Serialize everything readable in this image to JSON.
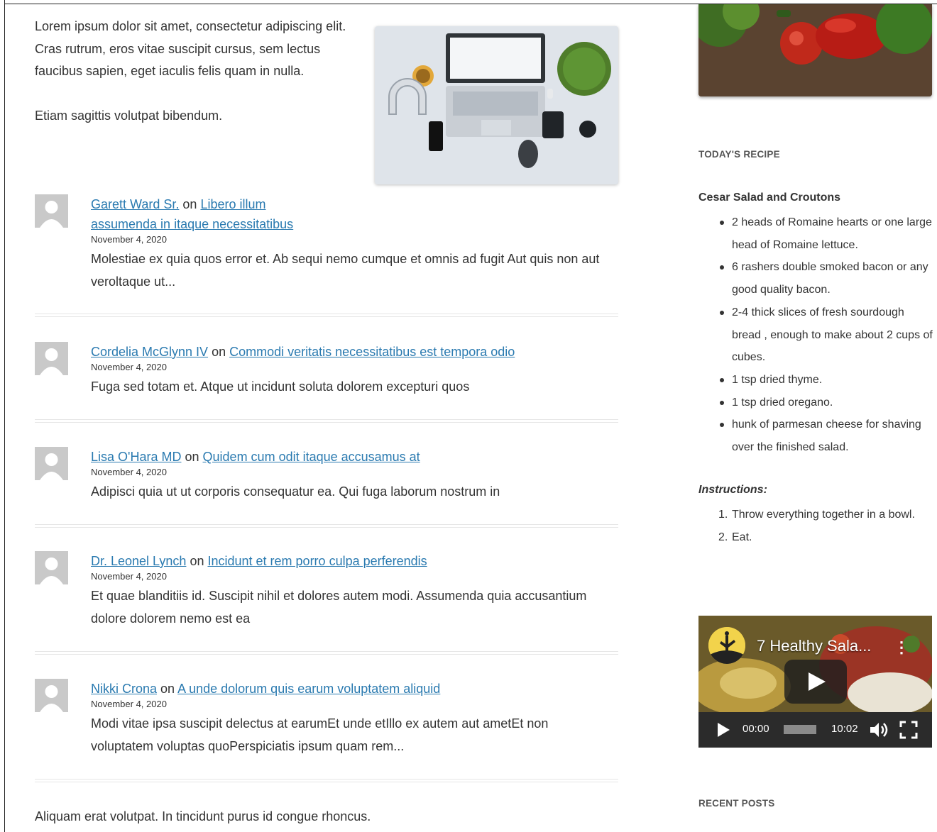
{
  "intro": {
    "paragraph1": "Lorem ipsum dolor sit amet, consectetur adipiscing elit. Cras rutrum, eros vitae suscipit cursus, sem lectus faucibus sapien, eget iaculis felis quam in nulla.",
    "paragraph2": "Etiam sagittis volutpat bibendum."
  },
  "comments": [
    {
      "author": "Garett Ward Sr.",
      "on": "on",
      "post": "Libero illum assumenda in itaque necessitatibus",
      "date": "November 4, 2020",
      "excerpt": "Molestiae ex quia quos error et. Ab sequi nemo cumque et omnis ad fugit Aut quis non aut veroltaque ut..."
    },
    {
      "author": "Cordelia McGlynn IV",
      "on": "on",
      "post": "Commodi veritatis necessitatibus est tempora odio",
      "date": "November 4, 2020",
      "excerpt": "Fuga sed totam et. Atque ut incidunt soluta dolorem excepturi quos"
    },
    {
      "author": "Lisa O'Hara MD",
      "on": "on",
      "post": "Quidem cum odit itaque accusamus at",
      "date": "November 4, 2020",
      "excerpt": "Adipisci quia ut ut corporis consequatur ea. Qui fuga laborum nostrum in"
    },
    {
      "author": "Dr. Leonel Lynch",
      "on": "on",
      "post": "Incidunt et rem porro culpa perferendis",
      "date": "November 4, 2020",
      "excerpt": "Et quae blanditiis id. Suscipit nihil et dolores autem modi. Assumenda quia accusantium dolore dolorem nemo est ea"
    },
    {
      "author": "Nikki Crona",
      "on": "on",
      "post": "A unde dolorum quis earum voluptatem aliquid",
      "date": "November 4, 2020",
      "excerpt": "Modi vitae ipsa suscipit delectus at earumEt unde etIllo ex autem aut ametEt non voluptatem voluptas quoPerspiciatis ipsum quam rem..."
    }
  ],
  "outro": "Aliquam erat volutpat. In tincidunt purus id congue rhoncus.",
  "sidebar": {
    "recipe_widget_title": "TODAY'S RECIPE",
    "recipe_title": "Cesar Salad and Croutons",
    "ingredients": [
      "2 heads of Romaine hearts or one large head of Romaine lettuce.",
      "6 rashers double smoked bacon or any good quality bacon.",
      "2-4 thick slices of fresh sourdough bread , enough to make about 2 cups of cubes.",
      "1 tsp dried thyme.",
      "1 tsp dried oregano.",
      "hunk of parmesan cheese for shaving over the finished salad."
    ],
    "instructions_label": "Instructions:",
    "steps": [
      {
        "num": "1.",
        "text": "Throw everything together in a bowl."
      },
      {
        "num": "2.",
        "text": "Eat."
      }
    ],
    "video": {
      "title": "7 Healthy Sala...",
      "menu": "⋮",
      "current_time": "00:00",
      "duration": "10:02"
    },
    "recent_posts_title": "RECENT POSTS"
  }
}
